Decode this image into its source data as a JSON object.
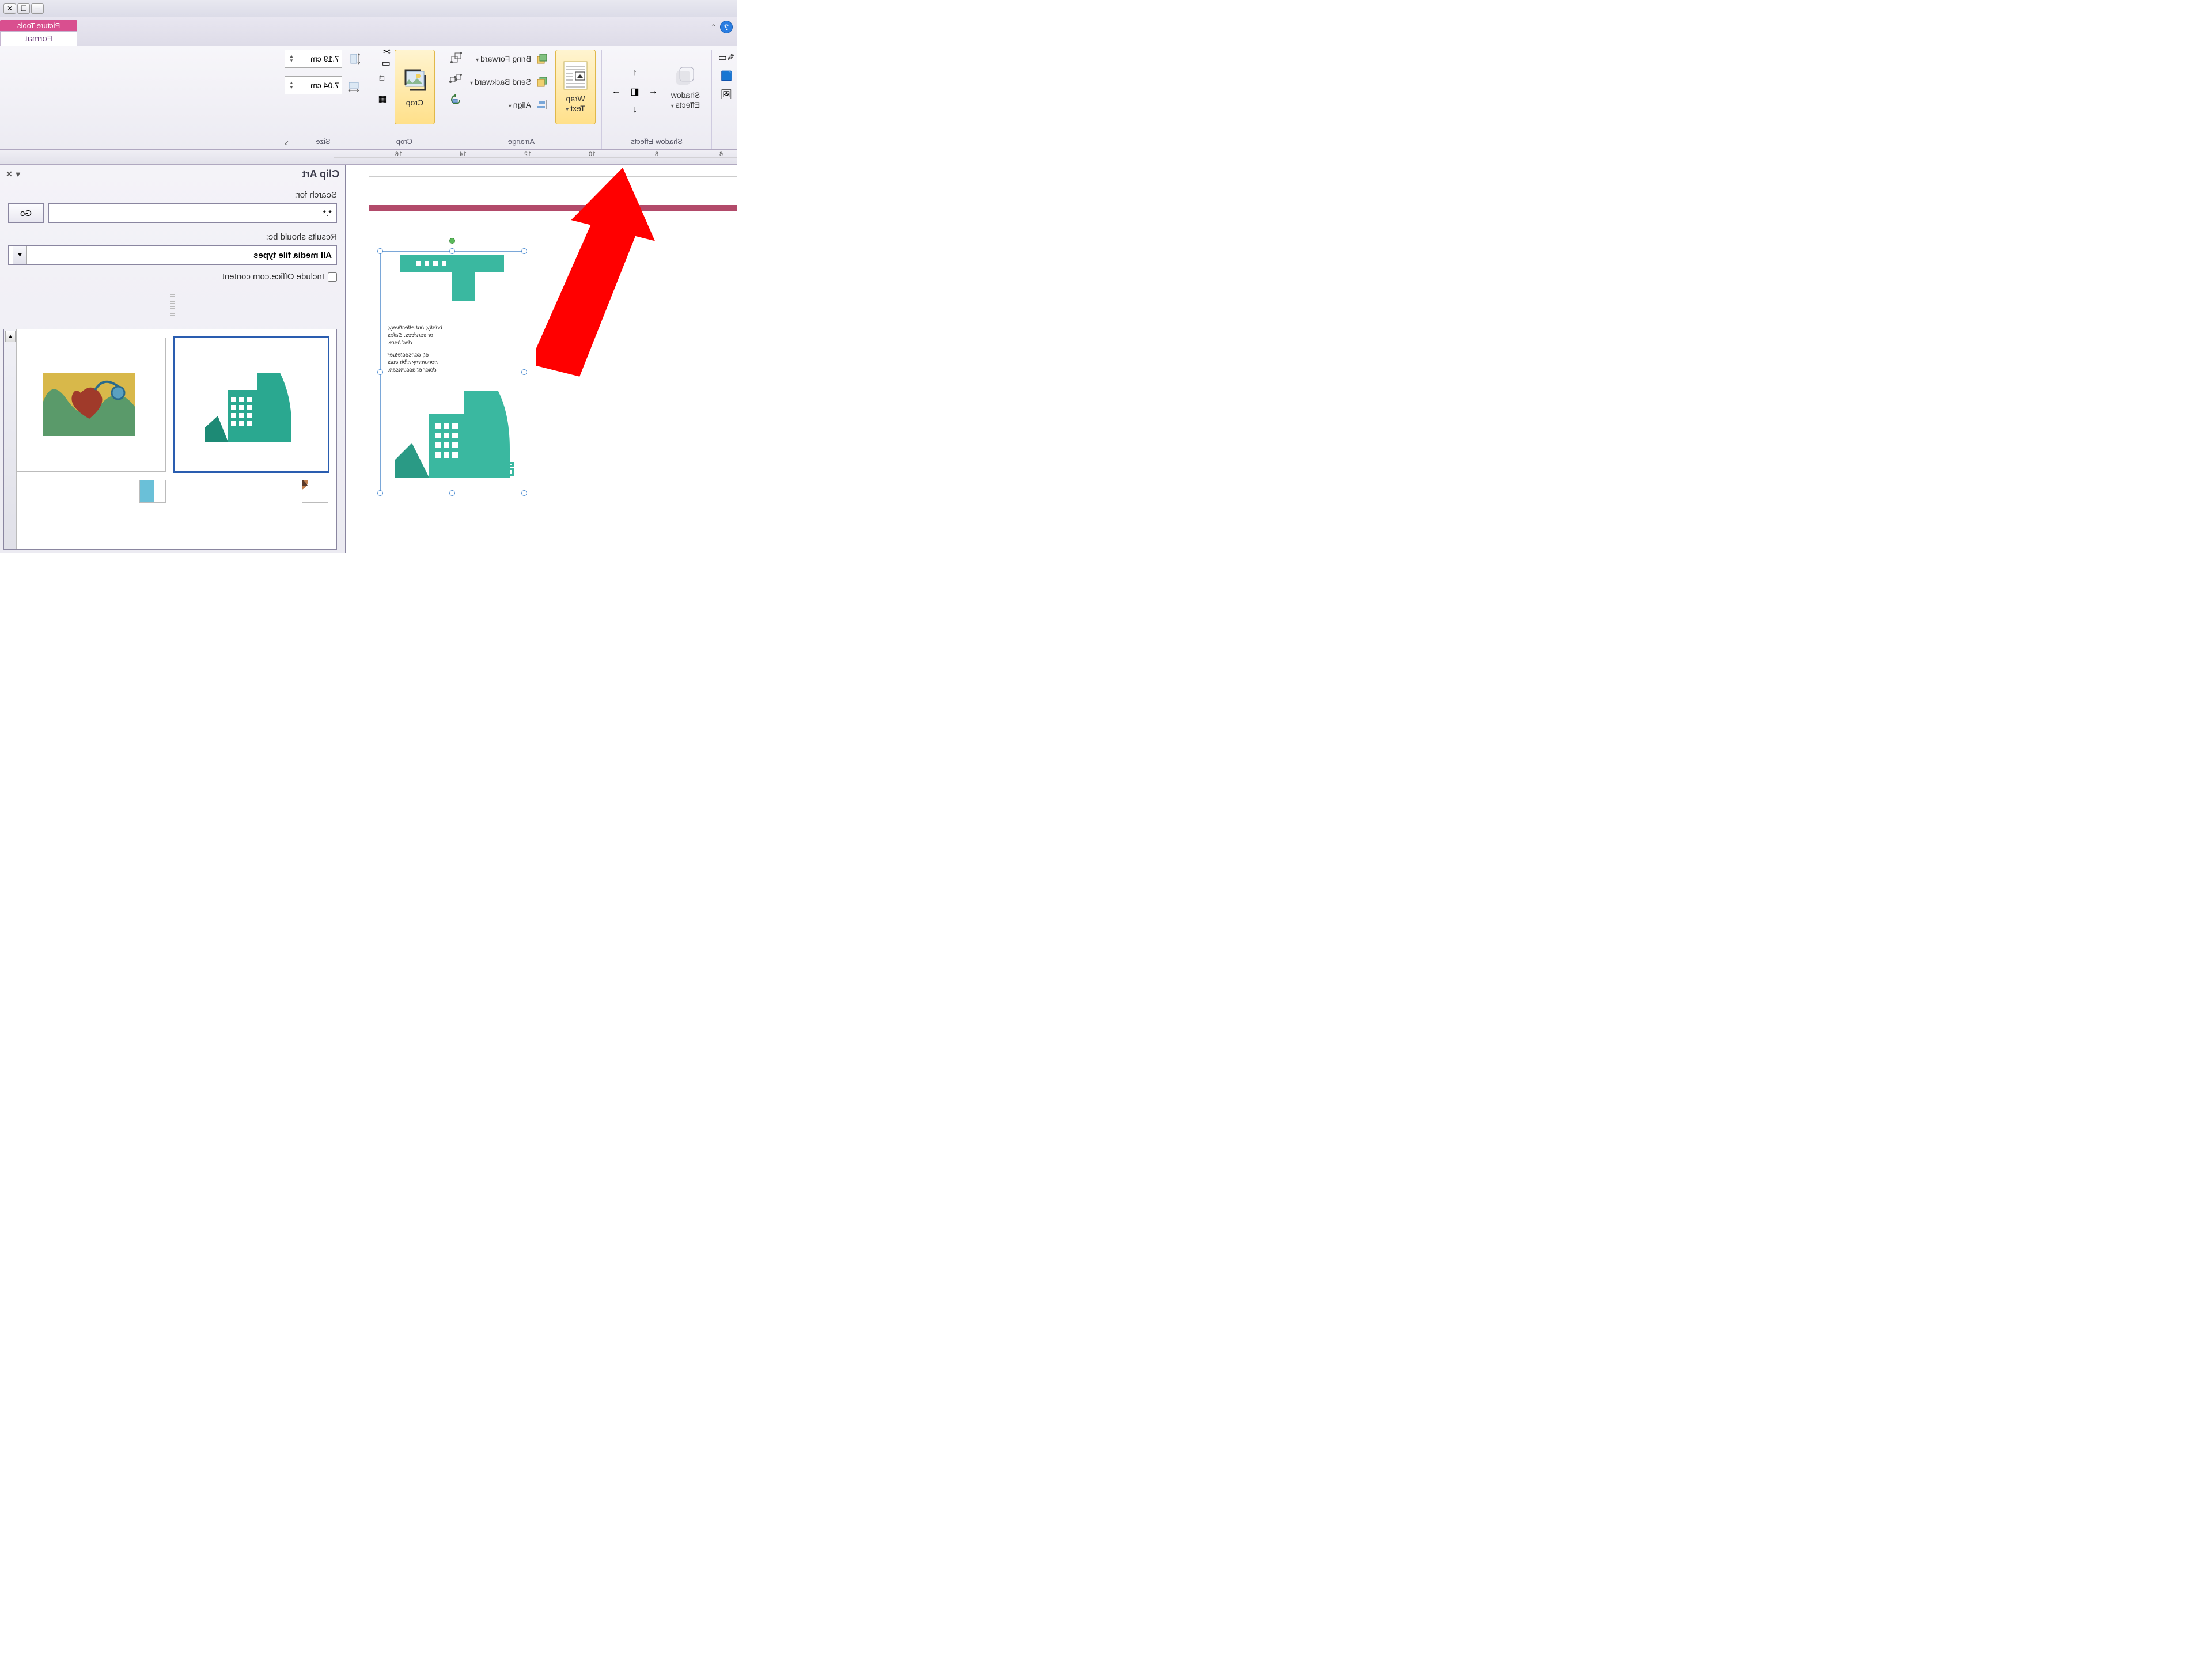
{
  "window": {
    "minimize_title": "Minimize",
    "restore_title": "Restore",
    "close_title": "Close"
  },
  "context_tab": {
    "group_title": "Picture Tools",
    "tab_label": "Format"
  },
  "ribbon": {
    "shadow_effects_group": "Shadow Effects",
    "shadow_effects_btn": "Shadow\nEffects",
    "arrange_group": "Arrange",
    "wrap_text": "Wrap\nText",
    "bring_forward": "Bring Forward",
    "send_backward": "Send Backward",
    "align": "Align",
    "crop_group": "Crop",
    "crop_btn": "Crop",
    "size_group": "Size",
    "height_value": "7.19 cm",
    "width_value": "7.04 cm"
  },
  "ruler_marks": [
    "6",
    "",
    "8",
    "",
    "10",
    "",
    "12",
    "",
    "14",
    "",
    "16",
    ""
  ],
  "taskpane": {
    "title": "Clip Art",
    "search_for_label": "Search for:",
    "search_value": "*.*",
    "go_label": "Go",
    "results_label": "Results should be:",
    "media_types": "All media file types",
    "include_label": "Include Office.com content"
  },
  "brochure": {
    "line1": "briefly, but effectively,",
    "line2": "or services. Sales",
    "line3": "ded here.",
    "line4": "et, consectetuer",
    "line5": "nonummy nibh euis",
    "line6": "dolor et accumsan."
  }
}
